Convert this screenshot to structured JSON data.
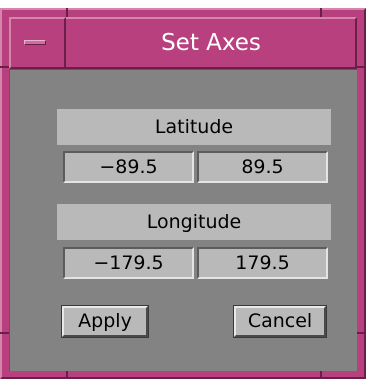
{
  "window": {
    "title": "Set Axes",
    "frame_color": "#b8407e",
    "client_color": "#838383",
    "widget_color": "#b9b9b9",
    "menu_icon": "window-menu-icon"
  },
  "latitude": {
    "label": "Latitude",
    "min_value": "−89.5",
    "max_value": "89.5"
  },
  "longitude": {
    "label": "Longitude",
    "min_value": "−179.5",
    "max_value": "179.5"
  },
  "buttons": {
    "apply_label": "Apply",
    "cancel_label": "Cancel"
  }
}
